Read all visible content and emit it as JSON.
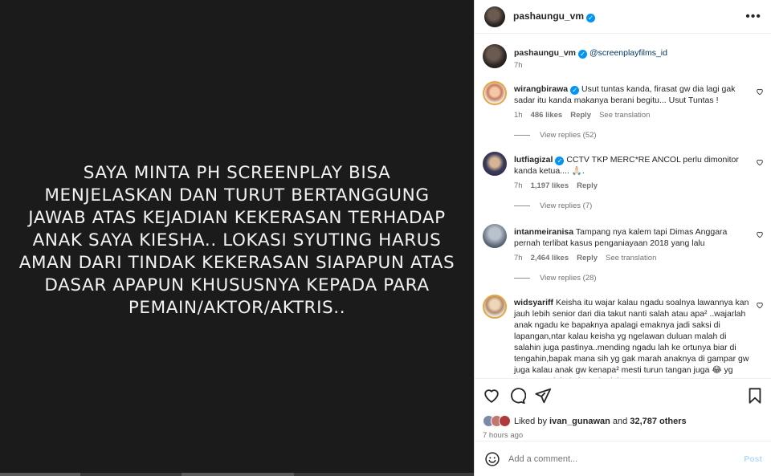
{
  "media": {
    "text": "SAYA MINTA PH SCREENPLAY BISA\nMENJELASKAN DAN TURUT BERTANGGUNG\nJAWAB ATAS KEJADIAN KEKERASAN TERHADAP\nANAK SAYA KIESHA.. LOKASI SYUTING HARUS\nAMAN DARI TINDAK KEKERASAN SIAPAPUN ATAS\nDASAR APAPUN KHUSUSNYA KEPADA PARA\nPEMAIN/AKTOR/AKTRIS.."
  },
  "header": {
    "username": "pashaungu_vm",
    "more": "•••"
  },
  "caption": {
    "username": "pashaungu_vm",
    "mention": "@screenplayfilms_id",
    "time": "7h"
  },
  "comments": [
    {
      "username": "wirangbirawa",
      "text": "Usut tuntas kanda, firasat gw dia lagi gak sadar itu kanda makanya berani begitu... Usut Tuntas !",
      "time": "1h",
      "likes": "486 likes",
      "reply": "Reply",
      "translation": "See translation",
      "view_replies": "View replies (52)"
    },
    {
      "username": "lutfiagizal",
      "text": "CCTV TKP MERC*RE ANCOL perlu dimonitor kanda ketua.... 🙏🏻.",
      "time": "7h",
      "likes": "1,197 likes",
      "reply": "Reply",
      "view_replies": "View replies (7)"
    },
    {
      "username": "intanmeiranisa",
      "text": "Tampang nya kalem tapi Dimas Anggara pernah terlibat kasus penganiayaan 2018 yang lalu",
      "time": "7h",
      "likes": "2,464 likes",
      "reply": "Reply",
      "translation": "See translation",
      "view_replies": "View replies (28)"
    },
    {
      "username": "widsyariff",
      "text": "Keisha itu wajar kalau ngadu soalnya lawannya kan jauh lebih senior dari dia takut nanti salah atau apa² ..wajarlah anak ngadu ke bapaknya apalagi emaknya jadi saksi di lapangan,ntar kalau keisha yg ngelawan duluan malah di salahin juga pastinya..mending ngadu lah ke ortunya biar di tengahin,bapak mana sih yg gak marah anaknya di gampar gw juga kalau anak gw kenapa² mesti turun tangan juga 😂 yg punya anak bakal rasain deh"
    }
  ],
  "likes_info": {
    "prefix": "Liked by",
    "user": "ivan_gunawan",
    "and": "and",
    "others": "32,787 others",
    "time": "7 hours ago"
  },
  "add_comment": {
    "placeholder": "Add a comment...",
    "post": "Post"
  }
}
